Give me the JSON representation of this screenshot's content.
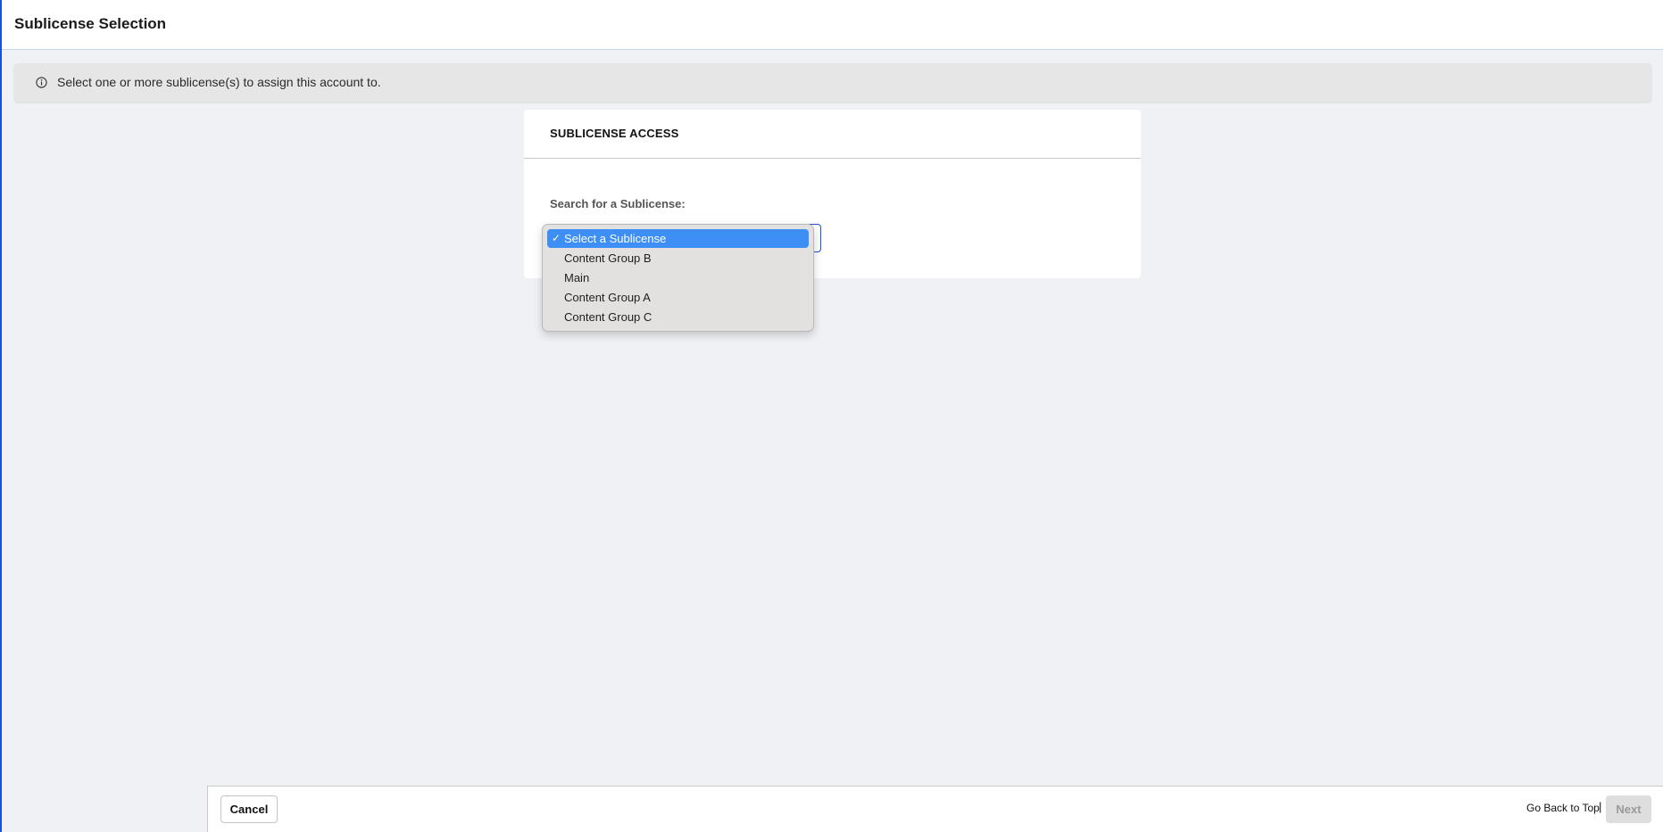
{
  "header": {
    "title": "Sublicense Selection"
  },
  "banner": {
    "icon": "info-icon",
    "text": "Select one or more sublicense(s) to assign this account to."
  },
  "card": {
    "title": "SUBLICENSE ACCESS",
    "search_label": "Search for a Sublicense:",
    "select": {
      "selected_value": "Select a Sublicense",
      "checkmark": "✓",
      "options": [
        "Select a Sublicense",
        "Content Group B",
        "Main",
        "Content Group A",
        "Content Group C"
      ]
    }
  },
  "footer": {
    "cancel_label": "Cancel",
    "back_to_top_label": "Go Back to Top",
    "separator": "|",
    "next_label": "Next"
  },
  "colors": {
    "accent": "#1f4fd6",
    "selected_option": "#3d8ff5",
    "page_background": "#eff1f4",
    "banner_background": "#e6e6e6",
    "disabled_button": "#dedede"
  }
}
